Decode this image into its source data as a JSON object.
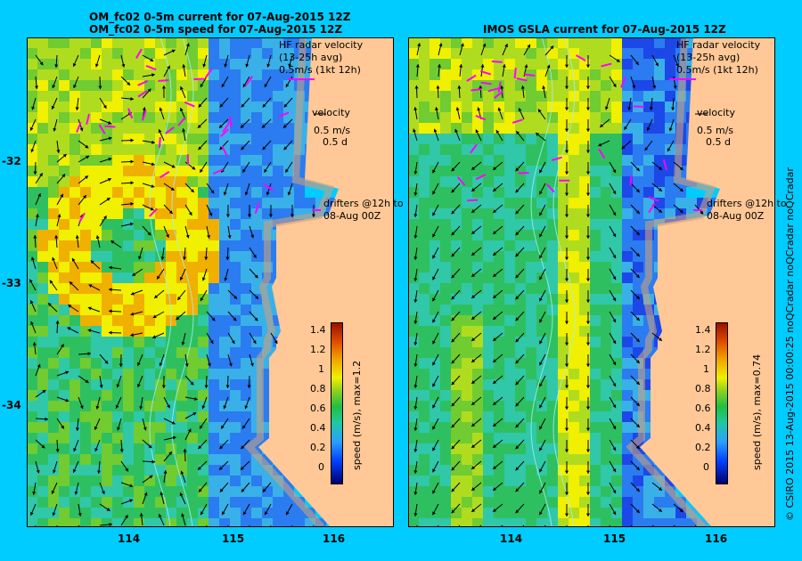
{
  "left_panel": {
    "title_line1": "OM_fc02 0-5m current for 07-Aug-2015 12Z",
    "title_line2": "OM_fc02 0-5m speed for 07-Aug-2015 12Z",
    "colorbar_label": "speed (m/s), max=1.2"
  },
  "right_panel": {
    "title": "IMOS GSLA current for 07-Aug-2015 12Z",
    "colorbar_label": "speed (m/s), max=0.74"
  },
  "legend": {
    "hf_line1": "HF radar velocity",
    "hf_line2": "(13-25h avg)",
    "hf_line3": "0.5m/s (1kt 12h)",
    "velocity": "velocity",
    "vel_speed": "0.5 m/s",
    "vel_time": "0.5 d",
    "drifters_line1": "drifters @12h to",
    "drifters_line2": "08-Aug 00Z"
  },
  "x_ticks": [
    "114",
    "115",
    "116"
  ],
  "y_ticks": [
    "-32",
    "-33",
    "-34"
  ],
  "colorbar_ticks": [
    "1.4",
    "1.2",
    "1",
    "0.8",
    "0.6",
    "0.4",
    "0.2",
    "0"
  ],
  "copyright": "© CSIRO 2015   13-Aug-2015 00:00:25 noQCradar noQCradar noQCradar",
  "colors": {
    "background": "#00ccff",
    "land": "#ffc896",
    "shelf": "#c8a080",
    "hf_radar": "#ff00ff",
    "arrows": "#000000"
  }
}
